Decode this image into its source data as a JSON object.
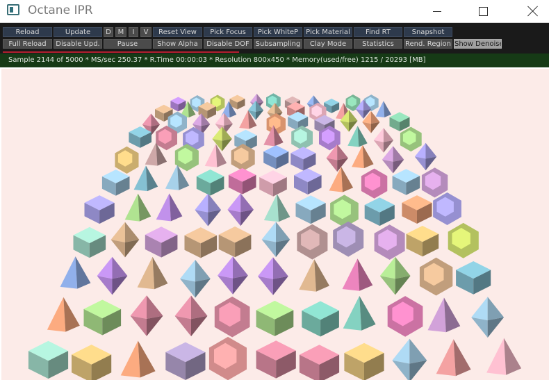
{
  "window": {
    "title": "Octane IPR"
  },
  "toolbar": {
    "row1": {
      "reload": "Reload",
      "update": "Update",
      "d": "D",
      "m": "M",
      "i": "I",
      "v": "V",
      "reset_view": "Reset View",
      "pick_focus": "Pick Focus",
      "pick_whitep": "Pick WhiteP",
      "pick_material": "Pick Material",
      "find_rt": "Find RT",
      "snapshot": "Snapshot"
    },
    "row2": {
      "full_reload": "Full Reload",
      "disable_upd": "Disable Upd.",
      "pause": "Pause",
      "show_alpha": "Show Alpha",
      "disable_dof": "Disable DOF",
      "subsampling": "Subsampling",
      "clay_mode": "Clay Mode",
      "statistics": "Statistics",
      "rend_region": "Rend. Region",
      "show_denoise": "Show Denoise"
    }
  },
  "status": {
    "text": "Sample 2144 of 5000 * MS/sec 250.37 * R.Time 00:00:03 * Resolution 800x450 * Memory(used/free) 1215 / 20293 [MB]",
    "progress_fraction": 0.43
  },
  "colors": {
    "viewport_bg": "#fcebe8",
    "status_bg": "#163a16",
    "toolbar_bg": "#1a1a1a",
    "progress": "#b31e2e"
  }
}
